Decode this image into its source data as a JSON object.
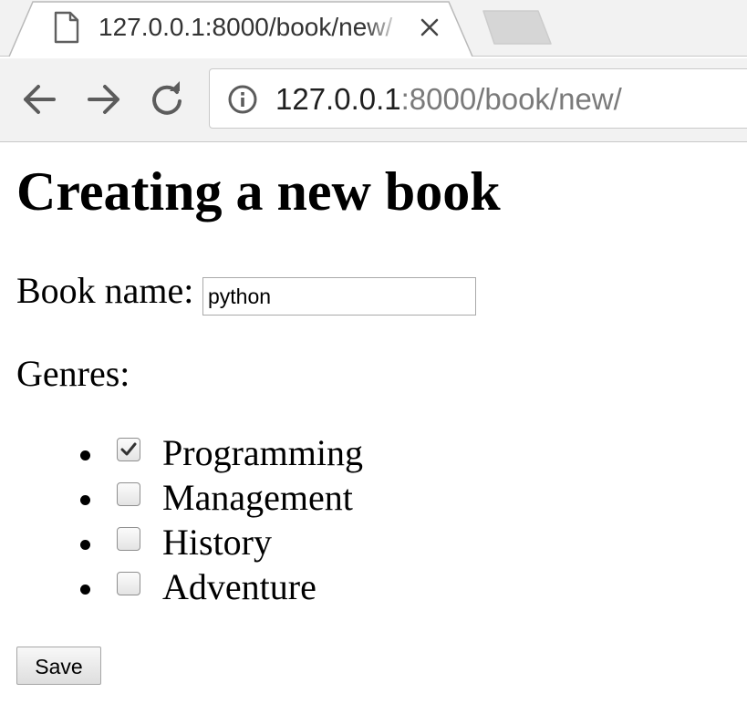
{
  "browser": {
    "tab": {
      "title": "127.0.0.1:8000/book/new/",
      "file_icon": "file-icon",
      "close_icon": "close-icon"
    },
    "new_tab_icon": "new-tab-icon",
    "nav": {
      "back_icon": "back-arrow-icon",
      "forward_icon": "forward-arrow-icon",
      "reload_icon": "reload-icon"
    },
    "address_bar": {
      "info_icon": "info-icon",
      "host": "127.0.0.1",
      "rest": ":8000/book/new/"
    }
  },
  "page": {
    "title": "Creating a new book",
    "book_name": {
      "label": "Book name:",
      "value": "python"
    },
    "genres": {
      "label": "Genres:",
      "items": [
        {
          "label": "Programming",
          "checked": true
        },
        {
          "label": "Management",
          "checked": false
        },
        {
          "label": "History",
          "checked": false
        },
        {
          "label": "Adventure",
          "checked": false
        }
      ]
    },
    "save_label": "Save"
  },
  "colors": {
    "chrome_background": "#f2f2f2",
    "url_rest_text": "#7a7a7a",
    "page_background": "#ffffff",
    "text": "#000000"
  }
}
